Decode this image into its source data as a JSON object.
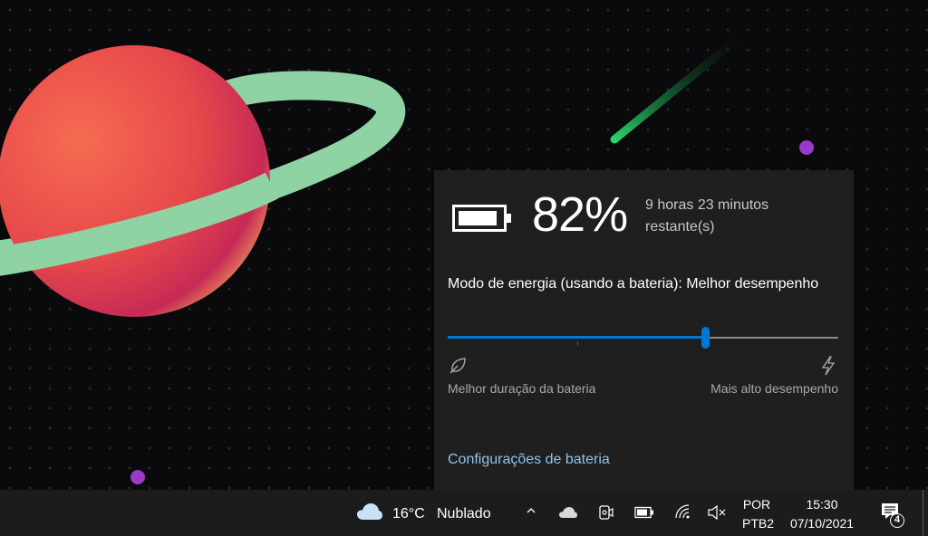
{
  "battery_flyout": {
    "percent": "82%",
    "remaining_line1": "9 horas 23 minutos",
    "remaining_line2": "restante(s)",
    "mode_label": "Modo de energia (usando a bateria): Melhor desempenho",
    "slider": {
      "min_label": "Melhor duração da bateria",
      "max_label": "Mais alto desempenho",
      "value": 0.66
    },
    "settings_link": "Configurações de bateria"
  },
  "taskbar": {
    "weather": {
      "icon": "cloud-icon",
      "temperature": "16°C",
      "condition": "Nublado"
    },
    "tray_icons": [
      "chevron-up-icon",
      "onedrive-icon",
      "meet-now-icon",
      "battery-icon",
      "wifi-icon",
      "volume-muted-icon"
    ],
    "language": {
      "line1": "POR",
      "line2": "PTB2"
    },
    "clock": {
      "time": "15:30",
      "date": "07/10/2021"
    },
    "notifications": {
      "icon": "notification-icon",
      "count": "4"
    }
  },
  "colors": {
    "accent": "#0078d4",
    "link": "#8fc3ee",
    "flyout_bg": "#1f1f1f",
    "taskbar_bg": "#1c1c1c"
  }
}
